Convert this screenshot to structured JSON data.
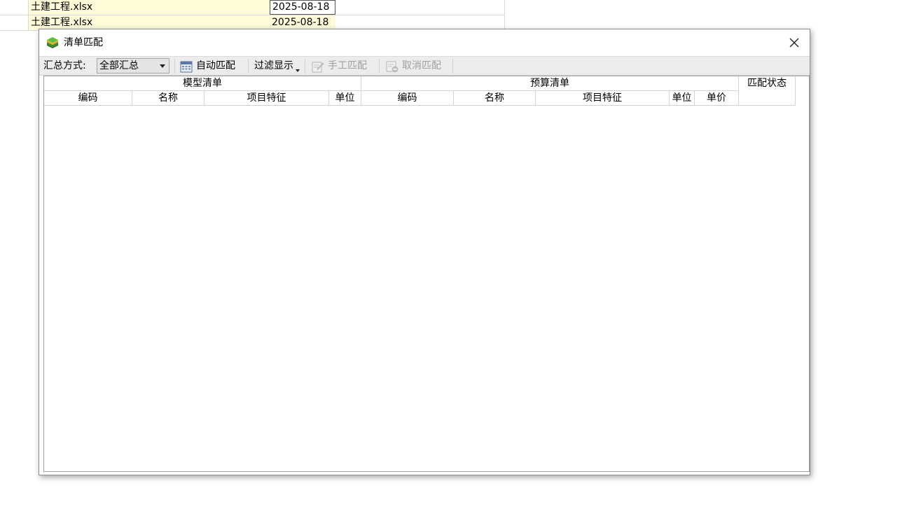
{
  "background_sheet": {
    "rows": [
      {
        "file": "土建工程.xlsx",
        "date": "2025-08-18"
      },
      {
        "file": "土建工程.xlsx",
        "date": "2025-08-18"
      }
    ]
  },
  "dialog": {
    "title": "清单匹配",
    "toolbar": {
      "summary_label": "汇总方式:",
      "summary_value": "全部汇总",
      "auto_match": "自动匹配",
      "filter_display": "过滤显示",
      "manual_match": "手工匹配",
      "cancel_match": "取消匹配"
    },
    "grid": {
      "group_model": "模型清单",
      "group_budget": "预算清单",
      "group_status": "匹配状态",
      "model_cols": [
        "编码",
        "名称",
        "项目特征",
        "单位"
      ],
      "budget_cols": [
        "编码",
        "名称",
        "项目特征",
        "单位",
        "单价"
      ]
    }
  },
  "colors": {
    "sheet_highlight": "#fdfbd8",
    "toolbar_bg": "#ececec",
    "grid_line": "#d4d4d4"
  }
}
